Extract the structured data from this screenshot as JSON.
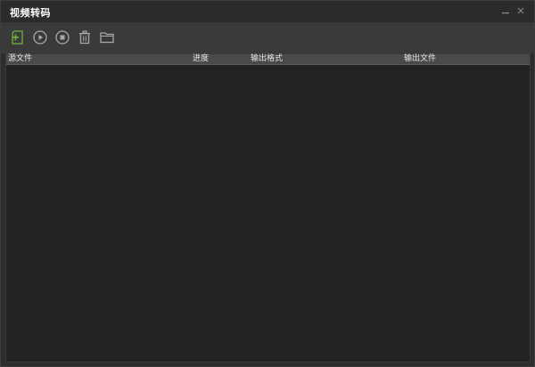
{
  "window": {
    "title": "视频转码",
    "minimize_glyph": "–",
    "close_glyph": "×"
  },
  "toolbar": {
    "buttons": [
      {
        "icon": "add-file-icon",
        "accent": "#6db33f"
      },
      {
        "icon": "play-icon"
      },
      {
        "icon": "stop-icon"
      },
      {
        "icon": "trash-icon"
      },
      {
        "icon": "folder-icon"
      }
    ]
  },
  "table": {
    "columns": [
      "源文件",
      "进度",
      "输出格式",
      "输出文件"
    ],
    "rows": []
  },
  "colors": {
    "background": "#232323",
    "titlebar": "#2b2b2b",
    "toolbar": "#3a3a3a",
    "header": "#4a4a4a",
    "icon": "#a8a8a8",
    "accent": "#6db33f"
  }
}
